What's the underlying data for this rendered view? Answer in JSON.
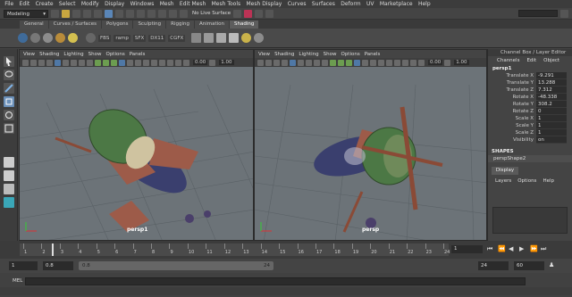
{
  "menubar": [
    "File",
    "Edit",
    "Create",
    "Select",
    "Modify",
    "Display",
    "Windows",
    "Mesh",
    "Edit Mesh",
    "Mesh Tools",
    "Mesh Display",
    "Curves",
    "Surfaces",
    "Deform",
    "UV",
    "Marketplace",
    "Help"
  ],
  "status": {
    "mode": "Modeling",
    "live_surface": "No Live Surface"
  },
  "shelf_tabs": [
    "General",
    "Curves / Surfaces",
    "Polygons",
    "Sculpting",
    "Rigging",
    "Animation",
    "Shading"
  ],
  "active_tab": "Shading",
  "shelf_text_buttons": [
    "FBS",
    "ramp",
    "SFX",
    "DX11",
    "CGFX"
  ],
  "viewport_menu": [
    "View",
    "Shading",
    "Lighting",
    "Show",
    "Options",
    "Panels"
  ],
  "viewport_field_value": "0.00",
  "viewport_field_value_2": "1.00",
  "viewports": [
    {
      "label": "persp1"
    },
    {
      "label": "persp"
    }
  ],
  "channel_box": {
    "title": "Channel Box / Layer Editor",
    "menu": [
      "Channels",
      "Edit",
      "Object"
    ],
    "object": "persp1",
    "attributes": [
      {
        "name": "Translate X",
        "value": "-9.291"
      },
      {
        "name": "Translate Y",
        "value": "13.288"
      },
      {
        "name": "Translate Z",
        "value": "7.312"
      },
      {
        "name": "Rotate X",
        "value": "-48.338"
      },
      {
        "name": "Rotate Y",
        "value": "308.2"
      },
      {
        "name": "Rotate Z",
        "value": "0"
      },
      {
        "name": "Scale X",
        "value": "1"
      },
      {
        "name": "Scale Y",
        "value": "1"
      },
      {
        "name": "Scale Z",
        "value": "1"
      },
      {
        "name": "Visibility",
        "value": "on"
      }
    ],
    "shapes_header": "SHAPES",
    "shape_name": "perspShape2",
    "display_tab": "Display",
    "layer_menu": [
      "Layers",
      "Options",
      "Help"
    ]
  },
  "timeline": {
    "ticks": [
      "1",
      "2",
      "3",
      "4",
      "5",
      "6",
      "7",
      "8",
      "9",
      "10",
      "11",
      "12",
      "13",
      "14",
      "15",
      "16",
      "17",
      "18",
      "19",
      "20",
      "21",
      "22",
      "23",
      "24"
    ],
    "current": "1"
  },
  "range": {
    "start": "1",
    "start_inner": "0.8",
    "bar_start": "0.8",
    "bar_end": "24",
    "end_inner": "24",
    "end": "60"
  },
  "mel_label": "MEL",
  "colors": {
    "viewport_bg": "#6c7378",
    "accent": "#5d8fc7"
  }
}
